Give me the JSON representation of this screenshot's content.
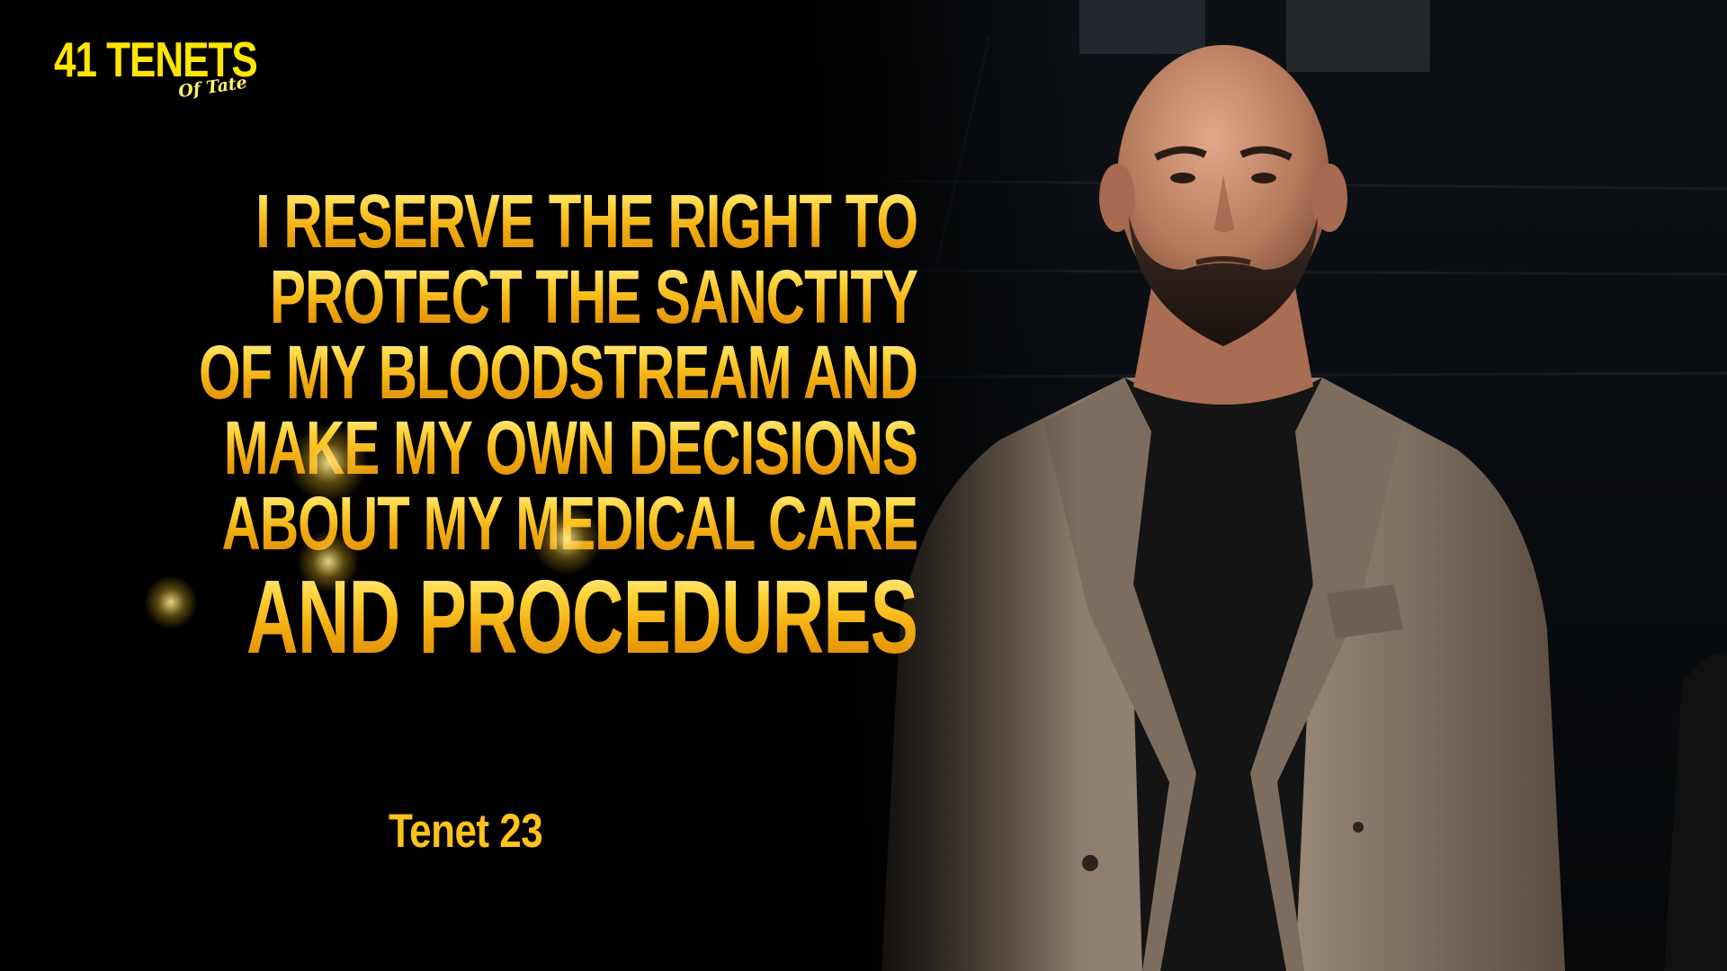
{
  "logo": {
    "main": "41 TENETS",
    "script": "Of Tate"
  },
  "quote": {
    "lines": [
      "I RESERVE THE RIGHT TO",
      "PROTECT THE SANCTITY",
      "OF MY BLOODSTREAM AND",
      "MAKE MY OWN DECISIONS",
      "ABOUT MY MEDICAL CARE",
      "AND PROCEDURES"
    ]
  },
  "tenet_label": "Tenet 23",
  "colors": {
    "background": "#000000",
    "gold_light": "#fff3a6",
    "gold_mid": "#ffd43b",
    "gold_dark": "#d9870a",
    "logo_yellow": "#ffe600",
    "jacket": "#8c7b6b",
    "shirt": "#141414",
    "skin": "#c98f6e"
  },
  "photo": {
    "subject": "man-in-tan-blazer-portrait"
  }
}
